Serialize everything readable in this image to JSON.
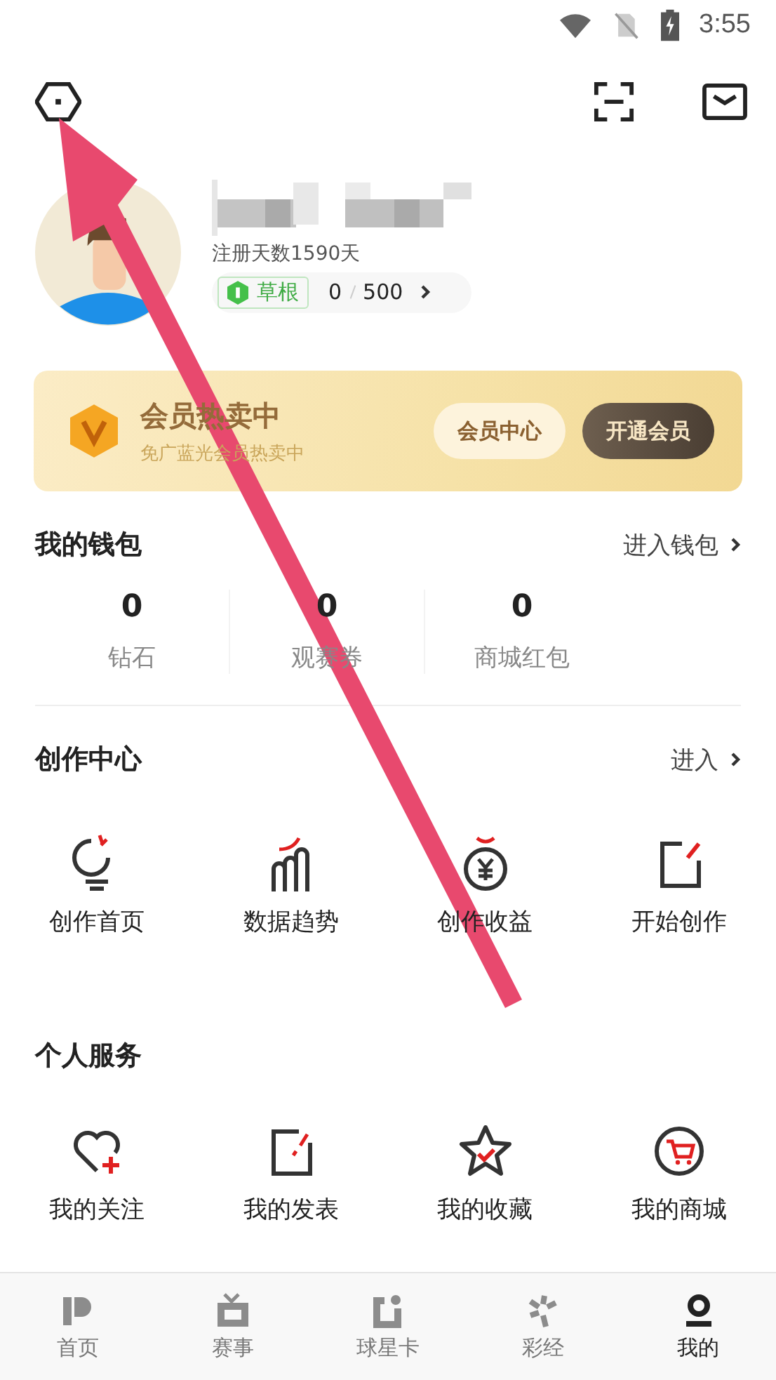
{
  "status_bar": {
    "time": "3:55"
  },
  "profile": {
    "register_days": "注册天数1590天",
    "level_badge": "草根",
    "progress": "0",
    "progress_total": "500"
  },
  "vip_banner": {
    "title": "会员热卖中",
    "subtitle": "免广蓝光会员热卖中",
    "buttons": [
      {
        "label": "会员中心",
        "kind": "light"
      },
      {
        "label": "开通会员",
        "kind": "dark"
      }
    ]
  },
  "wallet": {
    "title": "我的钱包",
    "link": "进入钱包",
    "items": [
      {
        "value": "0",
        "label": "钻石"
      },
      {
        "value": "0",
        "label": "观赛券"
      },
      {
        "value": "0",
        "label": "商城红包"
      }
    ]
  },
  "creation_center": {
    "title": "创作中心",
    "link": "进入",
    "items": [
      {
        "label": "创作首页",
        "kind": "bulb"
      },
      {
        "label": "数据趋势",
        "kind": "chart"
      },
      {
        "label": "创作收益",
        "kind": "coin"
      },
      {
        "label": "开始创作",
        "kind": "edit"
      }
    ]
  },
  "personal_services": {
    "title": "个人服务",
    "items": [
      {
        "label": "我的关注",
        "kind": "heart"
      },
      {
        "label": "我的发表",
        "kind": "post"
      },
      {
        "label": "我的收藏",
        "kind": "star"
      },
      {
        "label": "我的商城",
        "kind": "cart"
      }
    ]
  },
  "tab_bar": [
    {
      "label": "首页",
      "kind": "home",
      "selected": false
    },
    {
      "label": "赛事",
      "kind": "tv",
      "selected": false
    },
    {
      "label": "球星卡",
      "kind": "card",
      "selected": false
    },
    {
      "label": "彩经",
      "kind": "spark",
      "selected": false
    },
    {
      "label": "我的",
      "kind": "me",
      "selected": true
    }
  ]
}
